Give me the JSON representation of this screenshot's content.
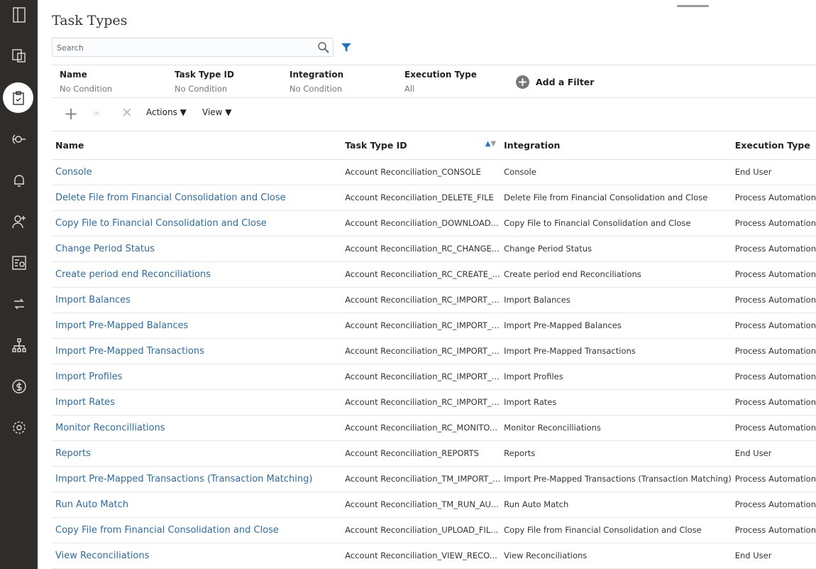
{
  "page": {
    "title": "Task Types"
  },
  "search": {
    "placeholder": "Search"
  },
  "filters": [
    {
      "label": "Name",
      "value": "No Condition"
    },
    {
      "label": "Task Type ID",
      "value": "No Condition"
    },
    {
      "label": "Integration",
      "value": "No Condition"
    },
    {
      "label": "Execution Type",
      "value": "All"
    }
  ],
  "add_filter": "Add a Filter",
  "toolbar": {
    "actions": "Actions ▼",
    "view": "View ▼"
  },
  "columns": [
    "Name",
    "Task Type ID",
    "Integration",
    "Execution Type"
  ],
  "rows": [
    [
      "Console",
      "Account Reconciliation_CONSOLE",
      "Console",
      "End User"
    ],
    [
      "Delete File from Financial Consolidation and Close",
      "Account Reconciliation_DELETE_FILE",
      "Delete File from Financial Consolidation and Close",
      "Process Automation"
    ],
    [
      "Copy File to Financial Consolidation and Close",
      "Account Reconciliation_DOWNLOAD...",
      "Copy File to Financial Consolidation and Close",
      "Process Automation"
    ],
    [
      "Change Period Status",
      "Account Reconciliation_RC_CHANGE...",
      "Change Period Status",
      "Process Automation"
    ],
    [
      "Create period end Reconciliations",
      "Account Reconciliation_RC_CREATE_...",
      "Create period end Reconciliations",
      "Process Automation"
    ],
    [
      "Import Balances",
      "Account Reconciliation_RC_IMPORT_...",
      "Import Balances",
      "Process Automation"
    ],
    [
      "Import Pre-Mapped Balances",
      "Account Reconciliation_RC_IMPORT_...",
      "Import Pre-Mapped Balances",
      "Process Automation"
    ],
    [
      "Import Pre-Mapped Transactions",
      "Account Reconciliation_RC_IMPORT_...",
      "Import Pre-Mapped Transactions",
      "Process Automation"
    ],
    [
      "Import Profiles",
      "Account Reconciliation_RC_IMPORT_...",
      "Import Profiles",
      "Process Automation"
    ],
    [
      "Import Rates",
      "Account Reconciliation_RC_IMPORT_...",
      "Import Rates",
      "Process Automation"
    ],
    [
      "Monitor Reconcilliations",
      "Account Reconciliation_RC_MONITO...",
      "Monitor Reconcilliations",
      "Process Automation"
    ],
    [
      "Reports",
      "Account Reconciliation_REPORTS",
      "Reports",
      "End User"
    ],
    [
      "Import Pre-Mapped Transactions (Transaction Matching)",
      "Account Reconciliation_TM_IMPORT_...",
      "Import Pre-Mapped Transactions (Transaction Matching)",
      "Process Automation"
    ],
    [
      "Run Auto Match",
      "Account Reconciliation_TM_RUN_AU...",
      "Run Auto Match",
      "Process Automation"
    ],
    [
      "Copy File from Financial Consolidation and Close",
      "Account Reconciliation_UPLOAD_FIL...",
      "Copy File from Financial Consolidation and Close",
      "Process Automation"
    ],
    [
      "View Reconciliations",
      "Account Reconciliation_VIEW_RECO...",
      "View Reconciliations",
      "End User"
    ]
  ],
  "colors": {
    "link": "#2b6ca3",
    "sidebar": "#2f2c29",
    "accent": "#1f74c4"
  }
}
